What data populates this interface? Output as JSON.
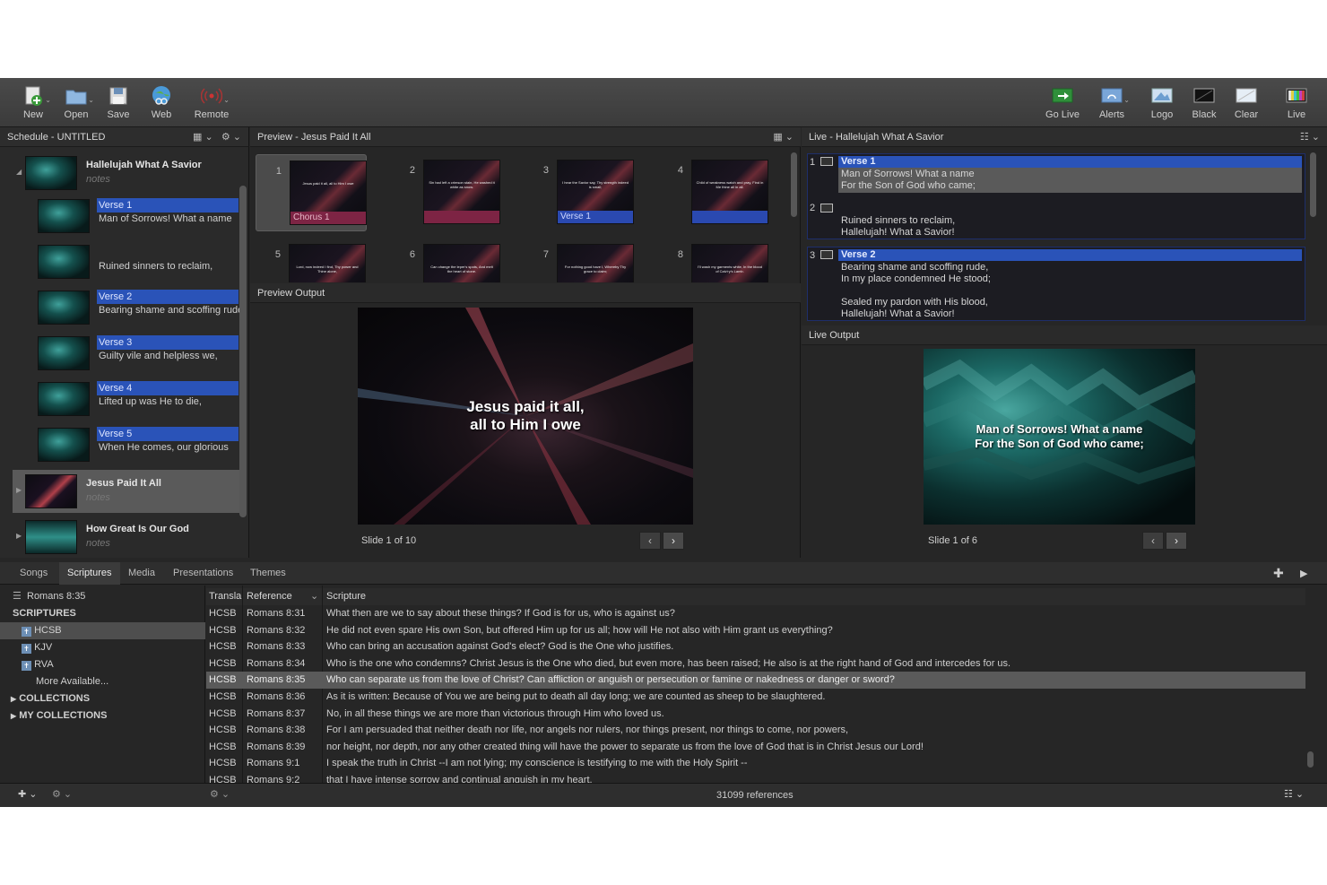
{
  "toolbar": {
    "new": "New",
    "open": "Open",
    "save": "Save",
    "web": "Web",
    "remote": "Remote",
    "go_live": "Go Live",
    "alerts": "Alerts",
    "logo": "Logo",
    "black": "Black",
    "clear": "Clear",
    "live": "Live"
  },
  "schedule": {
    "title": "Schedule - UNTITLED",
    "songs": [
      {
        "title": "Hallelujah What A Savior",
        "notes": "notes"
      },
      {
        "title": "Jesus Paid It All",
        "notes": "notes"
      },
      {
        "title": "How Great Is Our God",
        "notes": "notes"
      }
    ],
    "slides": [
      {
        "label": "Verse 1",
        "text": "Man of Sorrows! What a name"
      },
      {
        "label": "",
        "text": "Ruined sinners to reclaim,"
      },
      {
        "label": "Verse 2",
        "text": "Bearing shame and scoffing rude,"
      },
      {
        "label": "Verse 3",
        "text": "Guilty vile and helpless we,"
      },
      {
        "label": "Verse 4",
        "text": "Lifted up was He to die,"
      },
      {
        "label": "Verse 5",
        "text": "When He comes, our glorious"
      }
    ]
  },
  "preview": {
    "title": "Preview - Jesus Paid It All",
    "slides": [
      {
        "num": "1",
        "label": "Chorus 1",
        "text": "Jesus paid it all, all to Him I owe"
      },
      {
        "num": "2",
        "label": "",
        "text": "Sin had left a crimson stain, He washed it white as snow."
      },
      {
        "num": "3",
        "label": "Verse 1",
        "text": "I hear the Savior say, Thy strength indeed is small;"
      },
      {
        "num": "4",
        "label": "",
        "text": "Child of weakness watch and pray, Find in Me thine all in all."
      },
      {
        "num": "5",
        "label": "",
        "text": "Lord, now indeed I find, Thy power and Thine alone,"
      },
      {
        "num": "6",
        "label": "",
        "text": "Can change the leper's spots, And melt the heart of stone."
      },
      {
        "num": "7",
        "label": "",
        "text": "For nothing good have I, Whereby Thy grace to claim;"
      },
      {
        "num": "8",
        "label": "",
        "text": "I'll wash my garments white, In the blood of Calv'ry's Lamb."
      }
    ],
    "output_title": "Preview Output",
    "output_line1": "Jesus paid it all,",
    "output_line2": "all to Him I owe",
    "counter": "Slide 1 of 10"
  },
  "live": {
    "title": "Live - Hallelujah What A Savior",
    "slides": [
      {
        "num": "1",
        "label": "Verse 1",
        "lines": [
          "Man of Sorrows! What a name",
          "For the Son of God who came;"
        ]
      },
      {
        "num": "2",
        "label": "",
        "lines": [
          "Ruined sinners to reclaim,",
          "Hallelujah! What a Savior!"
        ]
      },
      {
        "num": "3",
        "label": "Verse 2",
        "lines": [
          "Bearing shame and scoffing rude,",
          "In my place condemned He stood;",
          "Sealed my pardon with His blood,",
          "Hallelujah! What a Savior!"
        ]
      }
    ],
    "output_title": "Live Output",
    "output_line1": "Man of Sorrows! What a name",
    "output_line2": "For the Son of God who came;",
    "counter": "Slide 1 of 6"
  },
  "library": {
    "tabs": [
      "Songs",
      "Scriptures",
      "Media",
      "Presentations",
      "Themes"
    ],
    "active_tab": "Scriptures",
    "current_ref": "Romans 8:35",
    "sidebar": {
      "scriptures_header": "SCRIPTURES",
      "translations": [
        "HCSB",
        "KJV",
        "RVA"
      ],
      "more": "More Available...",
      "collections": "COLLECTIONS",
      "my_collections": "MY COLLECTIONS"
    },
    "columns": [
      "Transla",
      "Reference",
      "Scripture"
    ],
    "rows": [
      [
        "HCSB",
        "Romans 8:31",
        "What then are we to say about these things? If God is for us, who is against us?"
      ],
      [
        "HCSB",
        "Romans 8:32",
        "He did not even spare His own Son, but offered Him up for us all; how will He not also with Him grant us everything?"
      ],
      [
        "HCSB",
        "Romans 8:33",
        "Who can bring an accusation against God's elect? God is the One who justifies."
      ],
      [
        "HCSB",
        "Romans 8:34",
        "Who is the one who condemns? Christ Jesus is the One who died, but even more, has been raised; He also is at the right hand of God and intercedes for us."
      ],
      [
        "HCSB",
        "Romans 8:35",
        "Who can separate us from the love of Christ? Can affliction or anguish or persecution or famine or nakedness or danger or sword?"
      ],
      [
        "HCSB",
        "Romans 8:36",
        "As it is written: Because of You we are being put to death all day long; we are counted as sheep to be slaughtered."
      ],
      [
        "HCSB",
        "Romans 8:37",
        "No, in all these things we are more than victorious through Him who loved us."
      ],
      [
        "HCSB",
        "Romans 8:38",
        "For I am persuaded that neither death nor life, nor angels nor rulers, nor things present, nor things to come, nor powers,"
      ],
      [
        "HCSB",
        "Romans 8:39",
        "nor height, nor depth, nor any other created thing will have the power to separate us from the love of God that is in Christ Jesus our Lord!"
      ],
      [
        "HCSB",
        "Romans 9:1",
        "I speak the truth in Christ --I am not lying; my conscience is testifying to me with the Holy Spirit --"
      ],
      [
        "HCSB",
        "Romans 9:2",
        "that I have intense sorrow and continual anguish in my heart."
      ]
    ],
    "count": "31099 references"
  }
}
